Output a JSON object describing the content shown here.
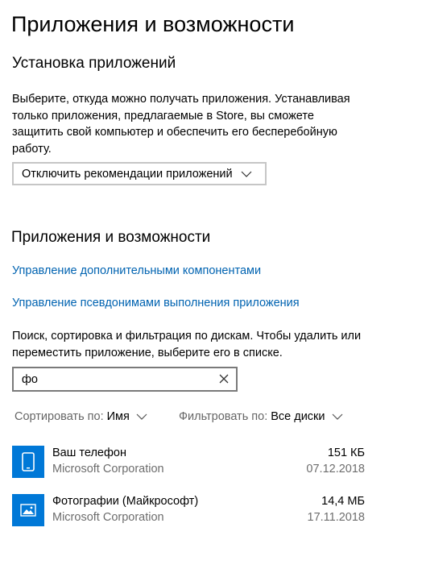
{
  "page_title": "Приложения и возможности",
  "install": {
    "title": "Установка приложений",
    "description": "Выберите, откуда можно получать приложения. Устанавливая только приложения, предлагаемые в Store, вы сможете защитить свой компьютер и обеспечить его бесперебойную работу.",
    "dropdown_value": "Отключить рекомендации приложений"
  },
  "apps": {
    "title": "Приложения и возможности",
    "link_optional": "Управление дополнительными компонентами",
    "link_aliases": "Управление псевдонимами выполнения приложения",
    "description": "Поиск, сортировка и фильтрация по дискам. Чтобы удалить или переместить приложение, выберите его в списке.",
    "search_value": "фо",
    "sort_label": "Сортировать по:",
    "sort_value": "Имя",
    "filter_label": "Фильтровать по:",
    "filter_value": "Все диски",
    "accent_color": "#0078d7",
    "list": [
      {
        "name": "Ваш телефон",
        "publisher": "Microsoft Corporation",
        "size": "151 КБ",
        "date": "07.12.2018",
        "icon": "phone-icon"
      },
      {
        "name": "Фотографии (Майкрософт)",
        "publisher": "Microsoft Corporation",
        "size": "14,4 МБ",
        "date": "17.11.2018",
        "icon": "photos-icon"
      }
    ]
  }
}
